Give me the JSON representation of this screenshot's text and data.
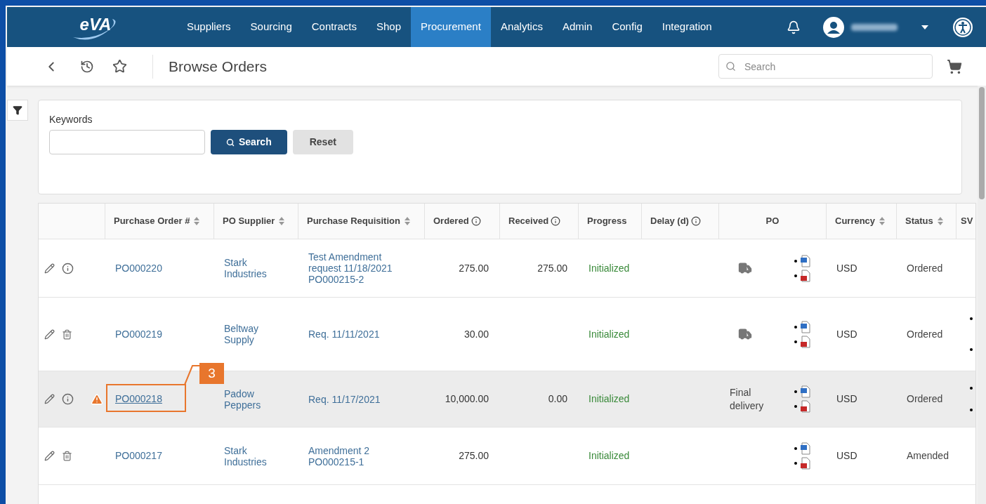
{
  "nav": {
    "logo": "eVA",
    "items": [
      {
        "label": "Suppliers",
        "selected": false
      },
      {
        "label": "Sourcing",
        "selected": false
      },
      {
        "label": "Contracts",
        "selected": false
      },
      {
        "label": "Shop",
        "selected": false
      },
      {
        "label": "Procurement",
        "selected": true
      },
      {
        "label": "Analytics",
        "selected": false
      },
      {
        "label": "Admin",
        "selected": false
      },
      {
        "label": "Config",
        "selected": false
      },
      {
        "label": "Integration",
        "selected": false
      }
    ]
  },
  "toolbar": {
    "title": "Browse Orders",
    "search_placeholder": "Search"
  },
  "filter": {
    "keywords_label": "Keywords",
    "search_button": "Search",
    "reset_button": "Reset"
  },
  "table": {
    "columns": [
      {},
      {
        "label": "Purchase Order #",
        "sortable": true
      },
      {
        "label": "PO Supplier",
        "sortable": true
      },
      {
        "label": "Purchase Requisition",
        "sortable": true
      },
      {
        "label": "Ordered",
        "info": true
      },
      {
        "label": "Received",
        "info": true
      },
      {
        "label": "Progress"
      },
      {
        "label": "Delay (d)",
        "info": true
      },
      {
        "label": "PO"
      },
      {
        "label": "Currency",
        "sortable": true
      },
      {
        "label": "Status",
        "sortable": true
      },
      {
        "label": "SV"
      }
    ],
    "rows": [
      {
        "kind": "info",
        "warning": false,
        "highlighted": false,
        "po": "PO000220",
        "supplier": "Stark Industries",
        "requisition": "Test Amendment request 11/18/2021 PO000215-2",
        "ordered": "275.00",
        "received": "275.00",
        "progress": "Initialized",
        "delivery_truck": true,
        "currency": "USD",
        "status": "Ordered",
        "sv_marks": false
      },
      {
        "kind": "delete",
        "warning": false,
        "highlighted": false,
        "po": "PO000219",
        "supplier": "Beltway Supply",
        "requisition": "Req. 11/11/2021",
        "ordered": "30.00",
        "progress": "Initialized",
        "delivery_truck": true,
        "currency": "USD",
        "status": "Ordered",
        "sv_marks": true
      },
      {
        "kind": "info",
        "warning": true,
        "highlighted": true,
        "po": "PO000218",
        "callout": "3",
        "supplier": "Padow Peppers",
        "requisition": "Req. 11/17/2021",
        "ordered": "10,000.00",
        "received": "0.00",
        "progress": "Initialized",
        "delivery_truck": false,
        "delivery_note": "Final delivery",
        "currency": "USD",
        "status": "Ordered",
        "sv_marks": true
      },
      {
        "kind": "delete",
        "warning": false,
        "highlighted": false,
        "po": "PO000217",
        "supplier": "Stark Industries",
        "requisition": "Amendment 2 PO000215-1",
        "ordered": "275.00",
        "progress": "Initialized",
        "delivery_truck": false,
        "currency": "USD",
        "status": "Amended",
        "sv_marks": false
      }
    ]
  }
}
